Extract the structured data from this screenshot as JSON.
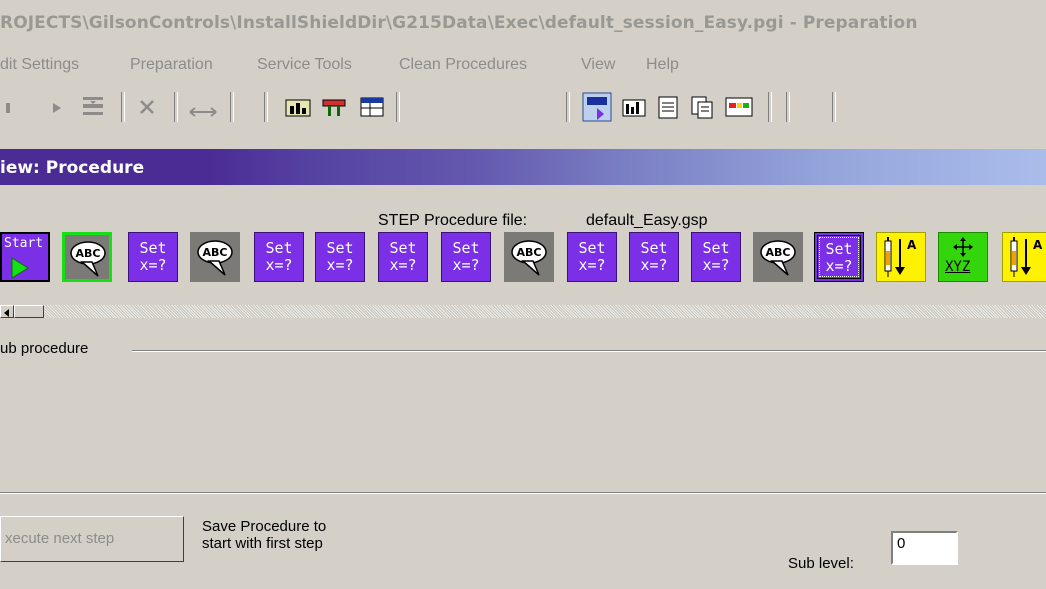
{
  "window": {
    "title": "ROJECTS\\GilsonControls\\InstallShieldDir\\G215Data\\Exec\\default_session_Easy.pgi - Preparation"
  },
  "menu": {
    "items": [
      "dit Settings",
      "Preparation",
      "Service Tools",
      "Clean Procedures",
      "View",
      "Help"
    ]
  },
  "view": {
    "title": "iew: Procedure"
  },
  "procedure": {
    "file_label": "STEP Procedure file:",
    "file_name": "default_Easy.gsp",
    "steps": [
      {
        "kind": "start",
        "label": "Start"
      },
      {
        "kind": "abc",
        "label": "ABC"
      },
      {
        "kind": "set",
        "line1": "Set",
        "line2": "x=?"
      },
      {
        "kind": "abc",
        "label": "ABC"
      },
      {
        "kind": "set",
        "line1": "Set",
        "line2": "x=?"
      },
      {
        "kind": "set",
        "line1": "Set",
        "line2": "x=?"
      },
      {
        "kind": "set",
        "line1": "Set",
        "line2": "x=?"
      },
      {
        "kind": "set",
        "line1": "Set",
        "line2": "x=?"
      },
      {
        "kind": "abc",
        "label": "ABC"
      },
      {
        "kind": "set",
        "line1": "Set",
        "line2": "x=?"
      },
      {
        "kind": "set",
        "line1": "Set",
        "line2": "x=?"
      },
      {
        "kind": "set",
        "line1": "Set",
        "line2": "x=?"
      },
      {
        "kind": "abc",
        "label": "ABC"
      },
      {
        "kind": "set",
        "line1": "Set",
        "line2": "x=?"
      },
      {
        "kind": "syringe",
        "label": "A"
      },
      {
        "kind": "xyz",
        "label": "XYZ"
      },
      {
        "kind": "syringe",
        "label": "A"
      }
    ]
  },
  "sub_procedure": {
    "label": "ub procedure"
  },
  "footer": {
    "execute_button": "xecute next step",
    "save_line1": "Save Procedure to",
    "save_line2": "start with first step",
    "sub_level_label": "Sub level:",
    "sub_level_value": "0"
  },
  "colors": {
    "header_start": "#4b2c94",
    "header_end": "#a9bdeb",
    "set_block": "#7b2fe6",
    "abc_block": "#7c7a76",
    "syringe_block": "#fff200",
    "xyz_block": "#33d60a"
  }
}
